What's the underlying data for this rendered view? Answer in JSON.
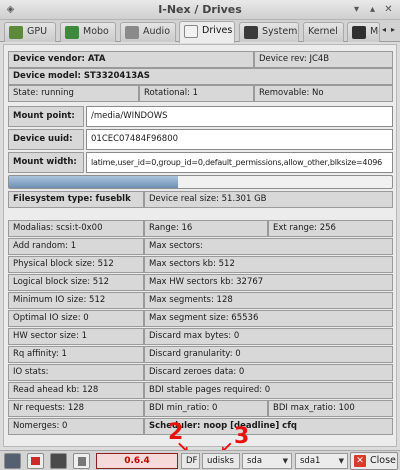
{
  "window": {
    "title": "I-Nex / Drives"
  },
  "tabs": [
    {
      "label": "GPU",
      "icon": "gpu-icon"
    },
    {
      "label": "Mobo",
      "icon": "motherboard-icon"
    },
    {
      "label": "Audio",
      "icon": "audio-icon"
    },
    {
      "label": "Drives",
      "icon": "drive-icon",
      "active": true
    },
    {
      "label": "System",
      "icon": "system-icon"
    },
    {
      "label": "Kernel",
      "icon": "kernel-icon"
    },
    {
      "label": "Me",
      "icon": "memory-icon"
    }
  ],
  "device": {
    "vendor": "Device vendor: ATA",
    "rev": "Device rev: JC4B",
    "model": "Device model: ST3320413AS",
    "state": "State: running",
    "rotational": "Rotational: 1",
    "removable": "Removable: No",
    "mount_point_label": "Mount point:",
    "mount_point": "/media/WINDOWS",
    "uuid_label": "Device uuid:",
    "uuid": "01CEC07484F96800",
    "mount_width_label": "Mount width:",
    "mount_width": "latime,user_id=0,group_id=0,default_permissions,allow_other,blksize=4096",
    "usage_fraction": 0.44,
    "fs_type": "Filesystem type: fuseblk",
    "real_size": "Device real size: 51.301 GB"
  },
  "stats": {
    "modalias": "Modalias: scsi:t-0x00",
    "range": "Range: 16",
    "ext_range": "Ext range: 256",
    "add_random": "Add random: 1",
    "max_sectors": "Max sectors:",
    "phys_block": "Physical block size: 512",
    "max_sectors_kb": "Max sectors kb: 512",
    "logical_block": "Logical block size: 512",
    "max_hw_sectors_kb": "Max HW sectors kb: 32767",
    "min_io": "Minimum IO size: 512",
    "max_segments": "Max segments: 128",
    "optimal_io": "Optimal IO size: 0",
    "max_segment_size": "Max segment size: 65536",
    "hw_sector": "HW sector size: 1",
    "discard_max": "Discard max bytes: 0",
    "rq_affinity": "Rq affinity: 1",
    "discard_gran": "Discard granularity: 0",
    "io_stats": "IO stats:",
    "discard_zeroes": "Discard zeroes data: 0",
    "read_ahead": "Read ahead kb: 128",
    "bdi_stable": "BDI stable pages required: 0",
    "nr_requests": "Nr requests: 128",
    "bdi_min": "BDI min_ratio: 0",
    "bdi_max": "BDI max_ratio: 100",
    "nomerges": "Nomerges: 0",
    "scheduler": "Scheduler: noop [deadline] cfq"
  },
  "statusbar": {
    "version": "0.6.4",
    "df_label": "DF",
    "udisks_label": "udisks",
    "sda_select": "sda",
    "sda1_select": "sda1",
    "close_label": "Close",
    "annotation_2": "2",
    "annotation_3": "3"
  },
  "colors": {
    "annotation": "#e8120c",
    "version_text": "#c00000",
    "progress_fill": "#6f90b3"
  }
}
